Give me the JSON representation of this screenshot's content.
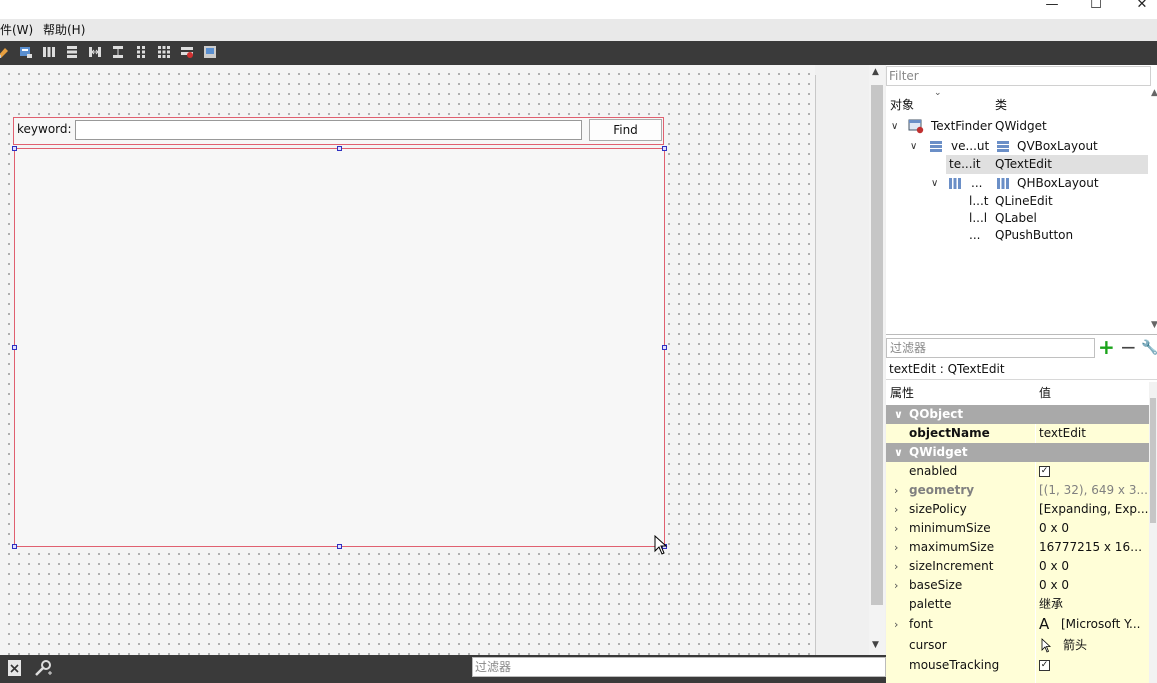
{
  "window": {
    "min_glyph": "—",
    "max_glyph": "☐",
    "close_glyph": "✕"
  },
  "menu": {
    "items": [
      "件(W)",
      "帮助(H)"
    ]
  },
  "form": {
    "keyword_label": "keyword:",
    "lineedit_value": "",
    "find_button": "Find"
  },
  "object_inspector": {
    "filter_placeholder": "Filter",
    "col_object": "对象",
    "col_class": "类",
    "rows": [
      {
        "name": "TextFinder",
        "cls": "QWidget"
      },
      {
        "name": "ve...ut",
        "cls": "QVBoxLayout"
      },
      {
        "name": "te...it",
        "cls": "QTextEdit"
      },
      {
        "name": "...",
        "cls": "QHBoxLayout"
      },
      {
        "name": "l...t",
        "cls": "QLineEdit"
      },
      {
        "name": "l...l",
        "cls": "QLabel"
      },
      {
        "name": "...",
        "cls": "QPushButton"
      }
    ]
  },
  "property_editor": {
    "filter_placeholder": "过滤器",
    "object_line": "textEdit : QTextEdit",
    "col_property": "属性",
    "col_value": "值",
    "groups": {
      "qobject": "QObject",
      "qwidget": "QWidget"
    },
    "props": [
      {
        "name": "objectName",
        "value": "textEdit"
      },
      {
        "name": "enabled",
        "value": "✓"
      },
      {
        "name": "geometry",
        "value": "[(1, 32), 649 x 3..."
      },
      {
        "name": "sizePolicy",
        "value": "[Expanding, Exp..."
      },
      {
        "name": "minimumSize",
        "value": "0 x 0"
      },
      {
        "name": "maximumSize",
        "value": "16777215 x 167..."
      },
      {
        "name": "sizeIncrement",
        "value": "0 x 0"
      },
      {
        "name": "baseSize",
        "value": "0 x 0"
      },
      {
        "name": "palette",
        "value": "继承"
      },
      {
        "name": "font",
        "value": "[Microsoft Y..."
      },
      {
        "name": "cursor",
        "value": "箭头"
      },
      {
        "name": "mouseTracking",
        "value": "✓"
      }
    ],
    "font_glyph": "A"
  },
  "bottom": {
    "filter_placeholder": "过滤器"
  },
  "colors": {
    "toolbar_bg": "#3a3a3a",
    "selection_outline": "#e06070",
    "handle": "#3030c0",
    "property_yellow": "#fffed7",
    "group_grey": "#a9a9a9",
    "plus_green": "#1aa31a"
  }
}
